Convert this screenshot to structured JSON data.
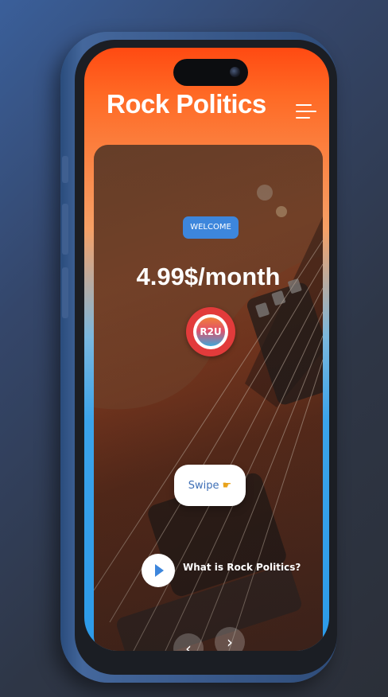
{
  "app": {
    "title": "Rock Politics"
  },
  "hero": {
    "badge": "WELCOME",
    "price": "4.99$/month",
    "logo_text": "R2U"
  },
  "actions": {
    "swipe_label": "Swipe",
    "swipe_icon": "hand-pointing-right-icon",
    "video_label": "What is Rock Politics?"
  },
  "nav": {
    "prev_glyph": "‹",
    "next_glyph": "›"
  },
  "colors": {
    "accent_blue": "#3d86dc",
    "header_orange": "#ff5a1a",
    "logo_red": "#e23b3b"
  }
}
